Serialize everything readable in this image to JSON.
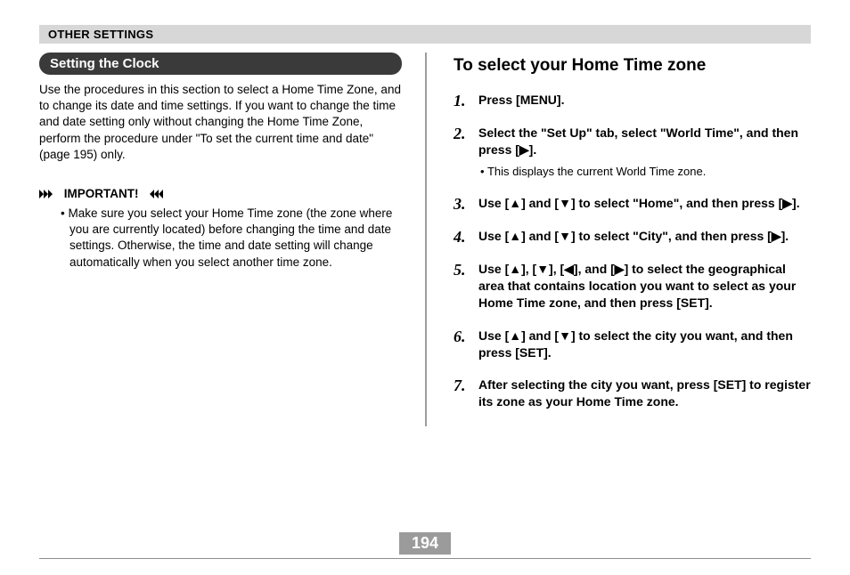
{
  "header": "OTHER SETTINGS",
  "left": {
    "pill": "Setting the Clock",
    "intro": "Use the procedures in this section to select a Home Time Zone, and to change its date and time settings. If you want to change the time and date setting only without changing the Home Time Zone, perform the procedure under \"To set the current time and date\" (page 195) only.",
    "important_label": "IMPORTANT!",
    "important_body": "Make sure you select your Home Time zone (the zone where you are currently located) before changing the time and date settings. Otherwise, the time and date setting will change automatically when you select another time zone."
  },
  "right": {
    "heading": "To select your Home Time zone",
    "steps": [
      {
        "text": "Press [MENU]."
      },
      {
        "text": "Select the \"Set Up\" tab, select \"World Time\", and then press [▶].",
        "sub": "This displays the current World Time zone."
      },
      {
        "text": "Use [▲] and [▼] to select \"Home\", and then press [▶]."
      },
      {
        "text": "Use [▲] and [▼] to select \"City\", and then press [▶]."
      },
      {
        "text": "Use [▲], [▼], [◀], and [▶] to select the geographical area that contains location you want to select as your Home Time zone, and then press [SET]."
      },
      {
        "text": "Use [▲] and [▼] to select the city you want, and then press [SET]."
      },
      {
        "text": "After selecting the city you want, press [SET] to register its zone as your Home Time zone."
      }
    ]
  },
  "page_number": "194"
}
